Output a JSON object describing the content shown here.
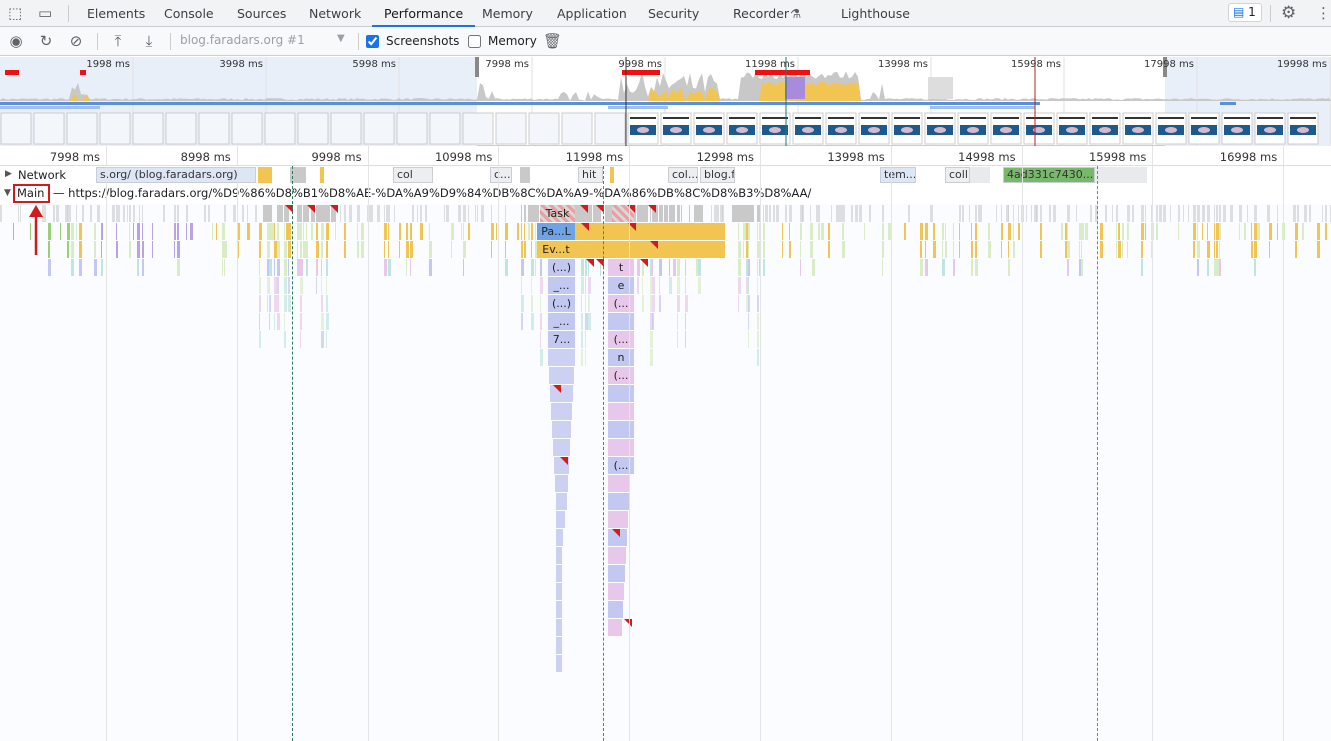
{
  "tabs": [
    "Elements",
    "Console",
    "Sources",
    "Network",
    "Performance",
    "Memory",
    "Application",
    "Security",
    "Recorder",
    "Lighthouse"
  ],
  "active_tab": "Performance",
  "issues_count": "1",
  "toolbar": {
    "target": "blog.faradars.org #1",
    "screenshots_label": "Screenshots",
    "screenshots_checked": true,
    "memory_label": "Memory",
    "memory_checked": false
  },
  "overview_ticks": [
    "1998 ms",
    "3998 ms",
    "5998 ms",
    "7998 ms",
    "9998 ms",
    "11998 ms",
    "13998 ms",
    "15998 ms",
    "17998 ms",
    "19998 ms"
  ],
  "ruler_ticks": [
    "7998 ms",
    "8998 ms",
    "9998 ms",
    "10998 ms",
    "11998 ms",
    "12998 ms",
    "13998 ms",
    "14998 ms",
    "15998 ms",
    "16998 ms"
  ],
  "network": {
    "label": "Network",
    "first_request": "s.org/ (blog.faradars.org)",
    "requests": [
      "col",
      "c...",
      "hit",
      "col...",
      "blog.fa",
      "tem...",
      "coll",
      "4ad331c7430..."
    ]
  },
  "main": {
    "label": "Main",
    "url": "https://blog.faradars.org/%D9%86%D8%B1%D8%AE-%DA%A9%D9%84%DB%8C%DA%A9-%DA%86%DB%8C%D8%B3%D8%AA/"
  },
  "flame_labels": {
    "task": "Task",
    "parse": "Pa...L",
    "event": "Ev...t",
    "c1": "(...)",
    "c2": "_...",
    "c3": "(...)",
    "c4": "_...",
    "c5": "7...",
    "d1": "t",
    "d2": "e",
    "d3": "(...",
    "d4": "(...",
    "d5": "n",
    "d6": "(...",
    "d7": "(..."
  },
  "colors": {
    "accent": "#1a73e8",
    "highlight": "#d01c1c",
    "script": "#f2c553",
    "task": "#c9c9c9",
    "rendering": "#a98bdd",
    "painting": "#7ec87a"
  }
}
